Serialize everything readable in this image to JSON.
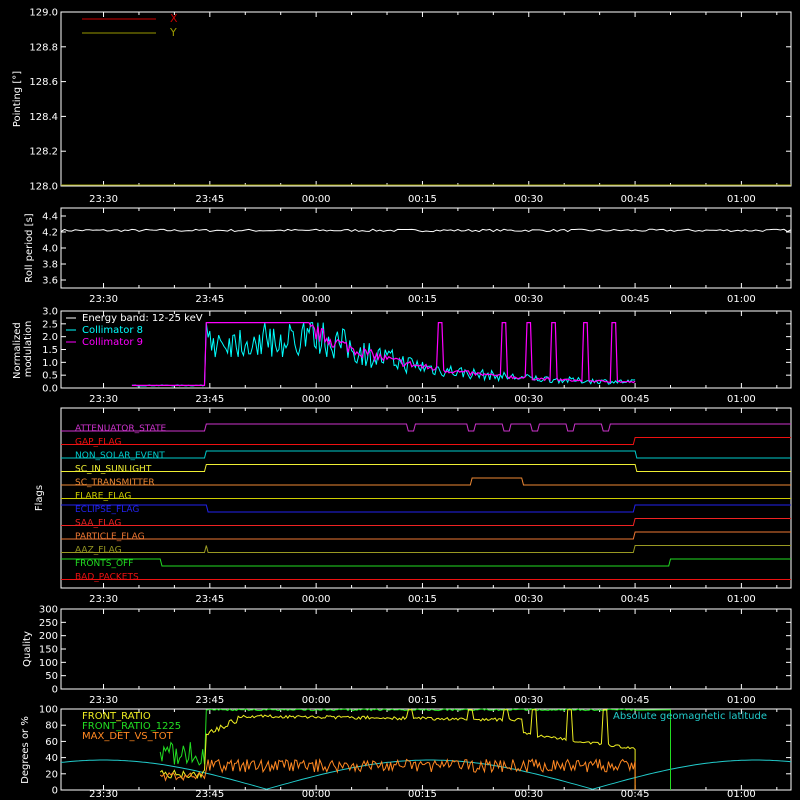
{
  "background": "#000000",
  "axis_color": "#ffffff",
  "time_ticks": [
    "23:30",
    "23:45",
    "00:00",
    "00:15",
    "00:30",
    "00:45",
    "01:00"
  ],
  "chart_data": [
    {
      "id": "pointing",
      "type": "line",
      "ylabel": "Pointing [°]",
      "ylim": [
        128.0,
        129.0
      ],
      "yticks": [
        "128.0",
        "128.2",
        "128.4",
        "128.6",
        "128.8",
        "129.0"
      ],
      "yticks_val": [
        128.0,
        128.2,
        128.4,
        128.6,
        128.8,
        129.0
      ],
      "legend": [
        {
          "name": "X",
          "color": "#cc0000"
        },
        {
          "name": "Y",
          "color": "#999900"
        }
      ]
    },
    {
      "id": "roll",
      "type": "line",
      "ylabel": "Roll period [s]",
      "ylim": [
        3.5,
        4.5
      ],
      "yticks": [
        "3.6",
        "3.8",
        "4.0",
        "4.2",
        "4.4"
      ],
      "yticks_val": [
        3.6,
        3.8,
        4.0,
        4.2,
        4.4
      ],
      "series": [
        {
          "color": "#ffffff",
          "value": 4.22
        }
      ]
    },
    {
      "id": "modulation",
      "type": "line",
      "ylabel": "Normalized modulation",
      "ylabel_lines": [
        "Normalized",
        "modulation"
      ],
      "ylim": [
        0.0,
        3.0
      ],
      "yticks": [
        "0.0",
        "0.5",
        "1.0",
        "1.5",
        "2.0",
        "2.5",
        "3.0"
      ],
      "yticks_val": [
        0,
        0.5,
        1,
        1.5,
        2,
        2.5,
        3
      ],
      "legend_title": "Energy band: 12-25 keV",
      "series": [
        {
          "name": "Collimator 8",
          "color": "#00ffff"
        },
        {
          "name": "Collimator 9",
          "color": "#ff00ff"
        }
      ]
    },
    {
      "id": "flags",
      "type": "line",
      "ylabel": "Flags",
      "flags": [
        {
          "name": "ATTENUATOR_STATE",
          "color": "#cc33cc"
        },
        {
          "name": "GAP_FLAG",
          "color": "#ee1111"
        },
        {
          "name": "NON_SOLAR_EVENT",
          "color": "#00cccc"
        },
        {
          "name": "SC_IN_SUNLIGHT",
          "color": "#eeee33"
        },
        {
          "name": "SC_TRANSMITTER",
          "color": "#ee8833"
        },
        {
          "name": "FLARE_FLAG",
          "color": "#cccc00"
        },
        {
          "name": "ECLIPSE_FLAG",
          "color": "#2222ee"
        },
        {
          "name": "SAA_FLAG",
          "color": "#ee2222"
        },
        {
          "name": "PARTICLE_FLAG",
          "color": "#ee7733"
        },
        {
          "name": "AAZ_FLAG",
          "color": "#999922"
        },
        {
          "name": "FRONTS_OFF",
          "color": "#22dd22"
        },
        {
          "name": "BAD_PACKETS",
          "color": "#ee1111"
        }
      ]
    },
    {
      "id": "quality",
      "type": "line",
      "ylabel": "Quality",
      "ylim": [
        0,
        300
      ],
      "yticks": [
        "0",
        "50",
        "100",
        "150",
        "200",
        "250",
        "300"
      ],
      "yticks_val": [
        0,
        50,
        100,
        150,
        200,
        250,
        300
      ]
    },
    {
      "id": "ratios",
      "type": "line",
      "ylabel": "Degrees or %",
      "ylim": [
        0,
        100
      ],
      "yticks": [
        "0",
        "20",
        "40",
        "60",
        "80",
        "100"
      ],
      "yticks_val": [
        0,
        20,
        40,
        60,
        80,
        100
      ],
      "series": [
        {
          "name": "FRONT_RATIO",
          "color": "#eeee22"
        },
        {
          "name": "FRONT_RATIO_1225",
          "color": "#22dd22"
        },
        {
          "name": "MAX_DET_VS_TOT",
          "color": "#ff8822"
        },
        {
          "name": "Absolute geomagnetic latitude",
          "color": "#22cccc"
        }
      ]
    }
  ]
}
